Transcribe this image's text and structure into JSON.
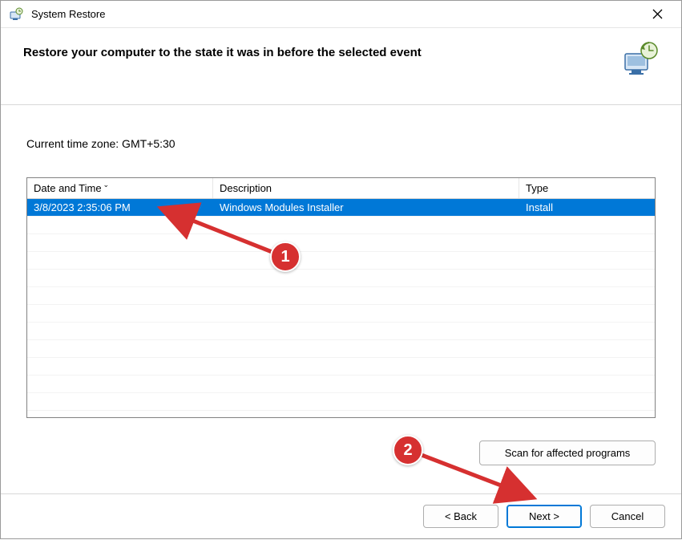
{
  "window": {
    "title": "System Restore"
  },
  "header": {
    "instruction": "Restore your computer to the state it was in before the selected event"
  },
  "content": {
    "timezone_label": "Current time zone: GMT+5:30"
  },
  "columns": {
    "datetime": "Date and Time",
    "description": "Description",
    "type": "Type"
  },
  "rows": [
    {
      "datetime": "3/8/2023 2:35:06 PM",
      "description": "Windows Modules Installer",
      "type": "Install",
      "selected": true
    }
  ],
  "buttons": {
    "scan": "Scan for affected programs",
    "back": "< Back",
    "next": "Next >",
    "cancel": "Cancel"
  },
  "annotations": {
    "badge1": "1",
    "badge2": "2"
  }
}
